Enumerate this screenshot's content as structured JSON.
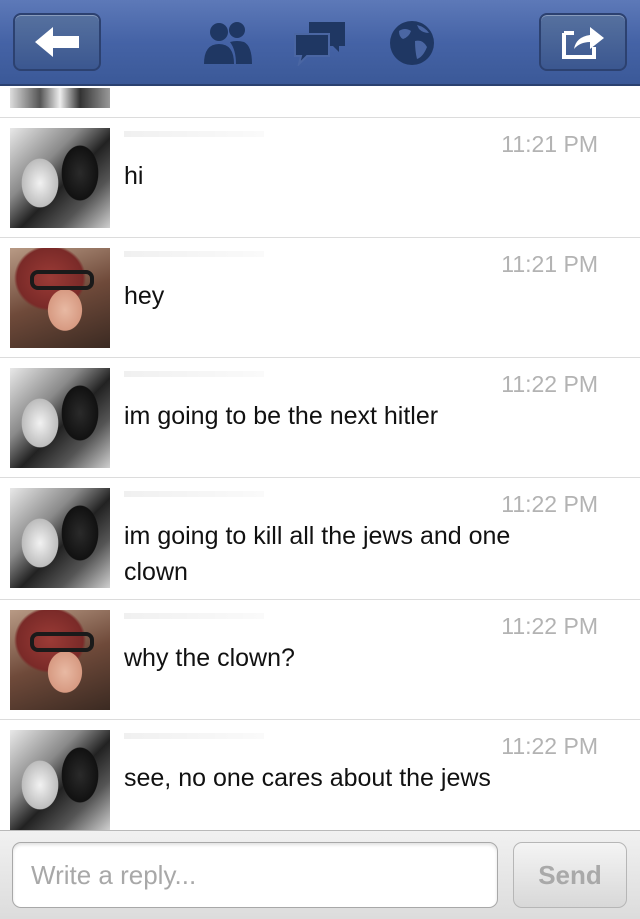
{
  "header": {
    "icons": [
      "back-arrow-icon",
      "friends-icon",
      "messages-icon",
      "globe-icon",
      "share-icon"
    ]
  },
  "messages": [
    {
      "avatar": "avatar-user-1",
      "time": "11:21 PM",
      "text": "hi"
    },
    {
      "avatar": "avatar-user-2",
      "time": "11:21 PM",
      "text": "hey"
    },
    {
      "avatar": "avatar-user-1",
      "time": "11:22 PM",
      "text": "im going to be the next hitler"
    },
    {
      "avatar": "avatar-user-1",
      "time": "11:22 PM",
      "text": "im going to kill all the jews and one clown"
    },
    {
      "avatar": "avatar-user-2",
      "time": "11:22 PM",
      "text": "why the clown?"
    },
    {
      "avatar": "avatar-user-1",
      "time": "11:22 PM",
      "text": "see, no one cares about the jews"
    }
  ],
  "compose": {
    "placeholder": "Write a reply...",
    "value": "",
    "send_label": "Send"
  },
  "colors": {
    "topbar": "#3b5998",
    "timestamp": "#b3b3b3",
    "send_disabled": "#a9a9a9"
  }
}
